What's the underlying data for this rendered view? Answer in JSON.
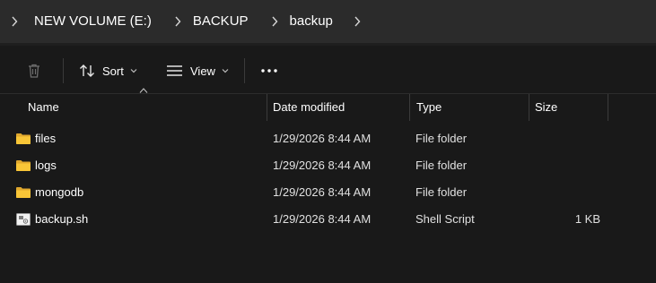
{
  "address": {
    "crumbs": [
      "NEW VOLUME (E:)",
      "BACKUP",
      "backup"
    ]
  },
  "toolbar": {
    "delete_icon": "trash-icon",
    "sort_label": "Sort",
    "view_label": "View",
    "more_icon": "ellipsis-icon"
  },
  "columns": {
    "name": "Name",
    "date": "Date modified",
    "type": "Type",
    "size": "Size"
  },
  "files": [
    {
      "name": "files",
      "date": "1/29/2026 8:44 AM",
      "type": "File folder",
      "size": "",
      "icon": "folder-icon"
    },
    {
      "name": "logs",
      "date": "1/29/2026 8:44 AM",
      "type": "File folder",
      "size": "",
      "icon": "folder-icon"
    },
    {
      "name": "mongodb",
      "date": "1/29/2026 8:44 AM",
      "type": "File folder",
      "size": "",
      "icon": "folder-icon"
    },
    {
      "name": "backup.sh",
      "date": "1/29/2026 8:44 AM",
      "type": "Shell Script",
      "size": "1 KB",
      "icon": "script-file-icon"
    }
  ],
  "colors": {
    "background": "#191919",
    "address_bar": "#2b2b2b",
    "folder": "#f8c537"
  }
}
